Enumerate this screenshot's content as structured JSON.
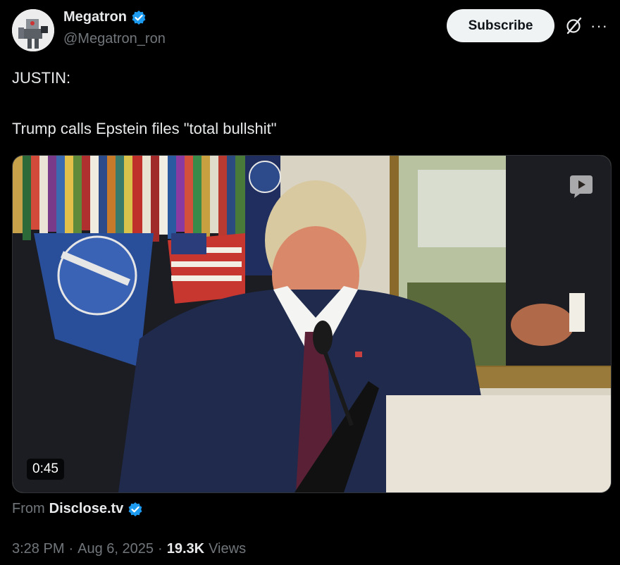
{
  "author": {
    "name": "Megatron",
    "handle": "@Megatron_ron",
    "verified_icon": "verified-badge-icon"
  },
  "header": {
    "subscribe_label": "Subscribe",
    "grok_icon": "grok-icon",
    "more_icon": "more-icon",
    "more_glyph": "···"
  },
  "tweet": {
    "line1": "JUSTIN:",
    "line2": "Trump calls Epstein files \"total bullshit\""
  },
  "media": {
    "duration": "0:45",
    "badge_icon": "gif-play-icon"
  },
  "source": {
    "prefix": "From",
    "name": "Disclose.tv"
  },
  "meta": {
    "time": "3:28 PM",
    "date": "Aug 6, 2025",
    "separator": "·",
    "views": "19.3K",
    "views_label": "Views"
  },
  "colors": {
    "background": "#000000",
    "text": "#e7e9ea",
    "muted": "#71767b",
    "verified": "#1d9bf0"
  }
}
